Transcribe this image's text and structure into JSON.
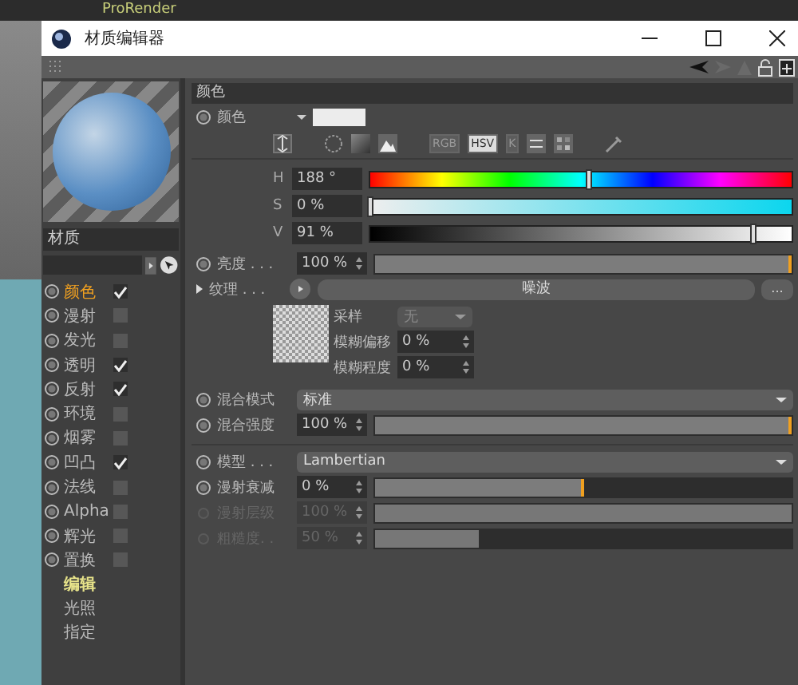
{
  "app_menu": [
    {
      "label": "ProRender"
    }
  ],
  "window": {
    "title": "材质编辑器"
  },
  "material": {
    "name": "材质"
  },
  "channels": [
    {
      "label": "颜色",
      "checked": true,
      "selected": true
    },
    {
      "label": "漫射",
      "checked": false,
      "selected": false
    },
    {
      "label": "发光",
      "checked": false,
      "selected": false
    },
    {
      "label": "透明",
      "checked": true,
      "selected": false
    },
    {
      "label": "反射",
      "checked": true,
      "selected": false
    },
    {
      "label": "环境",
      "checked": false,
      "selected": false
    },
    {
      "label": "烟雾",
      "checked": false,
      "selected": false
    },
    {
      "label": "凹凸",
      "checked": true,
      "selected": false
    },
    {
      "label": "法线",
      "checked": false,
      "selected": false
    },
    {
      "label": "Alpha",
      "checked": false,
      "selected": false
    },
    {
      "label": "辉光",
      "checked": false,
      "selected": false
    },
    {
      "label": "置换",
      "checked": false,
      "selected": false
    }
  ],
  "views": [
    {
      "label": "编辑",
      "selected": true
    },
    {
      "label": "光照",
      "selected": false
    },
    {
      "label": "指定",
      "selected": false
    }
  ],
  "section": {
    "title": "颜色"
  },
  "color": {
    "label": "颜色",
    "modes": [
      {
        "label": "RGB",
        "selected": false
      },
      {
        "label": "HSV",
        "selected": true
      },
      {
        "label": "K",
        "selected": false
      }
    ],
    "sliders": [
      {
        "kind": "hue",
        "label": "H",
        "value": "188 °",
        "level": 0.52
      },
      {
        "kind": "saturation",
        "label": "S",
        "value": "0 %",
        "level": 0
      },
      {
        "kind": "brightness",
        "label": "V",
        "value": "91 %",
        "level": 0.91
      }
    ]
  },
  "groups": [
    [
      {
        "kind": "slider",
        "label": "亮度 . . .",
        "value": "100 %",
        "level": 1,
        "disabled": false
      },
      {
        "kind": "texture",
        "label": "纹理 . . .",
        "shader": "噪波",
        "more": "...",
        "sampling_label": "采样",
        "sampling": "无",
        "fields": [
          {
            "label": "模糊偏移",
            "value": "0 %"
          },
          {
            "label": "模糊程度",
            "value": "0 %"
          }
        ]
      },
      {
        "kind": "dropdown",
        "label": "混合模式",
        "value": "标准"
      },
      {
        "kind": "slider",
        "label": "混合强度",
        "value": "100 %",
        "level": 1,
        "disabled": false
      }
    ],
    [
      {
        "kind": "dropdown",
        "label": "模型 . . .",
        "value": "Lambertian"
      },
      {
        "kind": "slider",
        "label": "漫射衰减",
        "value": "0 %",
        "level": 0.5,
        "disabled": false
      },
      {
        "kind": "slider",
        "label": "漫射层级",
        "value": "100 %",
        "level": 1,
        "disabled": true
      },
      {
        "kind": "slider",
        "label": "粗糙度. .",
        "value": "50 %",
        "level": 0.25,
        "disabled": true
      }
    ]
  ]
}
